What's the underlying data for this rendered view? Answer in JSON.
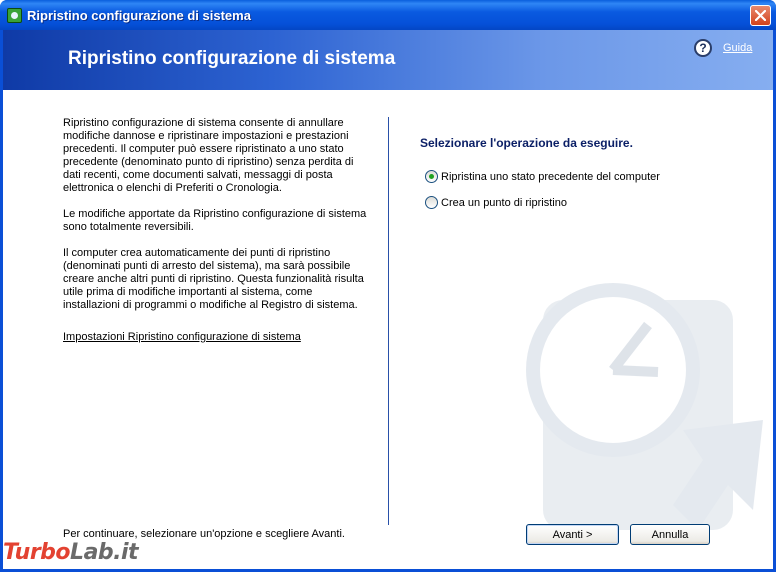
{
  "window": {
    "title": "Ripristino configurazione di sistema",
    "close_label": "×"
  },
  "header": {
    "title": "Ripristino configurazione di sistema",
    "help_label": "Guida"
  },
  "left_panel": {
    "paragraphs": [
      "Ripristino configurazione di sistema consente di annullare modifiche dannose e ripristinare impostazioni e prestazioni precedenti. Il computer può essere ripristinato a uno stato precedente (denominato punto di ripristino) senza perdita di dati recenti, come documenti salvati, messaggi di posta elettronica o elenchi di Preferiti o Cronologia.",
      "Le modifiche apportate da Ripristino configurazione di sistema sono totalmente reversibili.",
      "Il computer crea automaticamente dei punti di ripristino (denominati punti di arresto del sistema), ma sarà possibile creare anche altri punti di ripristino. Questa funzionalità risulta utile prima di modifiche importanti al sistema, come installazioni di programmi o modifiche al Registro di sistema."
    ],
    "settings_link": "Impostazioni Ripristino configurazione di sistema",
    "footer": "Per continuare, selezionare un'opzione e scegliere Avanti."
  },
  "right_panel": {
    "question": "Selezionare l'operazione da eseguire.",
    "options": [
      {
        "label": "Ripristina uno stato precedente del computer",
        "checked": true
      },
      {
        "label": "Crea un punto di ripristino",
        "checked": false
      }
    ]
  },
  "buttons": {
    "next": "Avanti >",
    "cancel": "Annulla"
  },
  "watermark_brand": {
    "part1": "Turbo",
    "part2": "Lab.it"
  },
  "colors": {
    "titlebar": "#0550d8",
    "header_start": "#0f3aa6",
    "header_end": "#86aef0",
    "question_text": "#0b1f66",
    "divider": "#2950a8",
    "radio_checked": "#21a121",
    "brand_red": "#e02e1b"
  },
  "icons": {
    "app": "system-restore-icon",
    "help": "help-icon",
    "close": "close-icon",
    "watermark": "clock-restore-icon"
  }
}
